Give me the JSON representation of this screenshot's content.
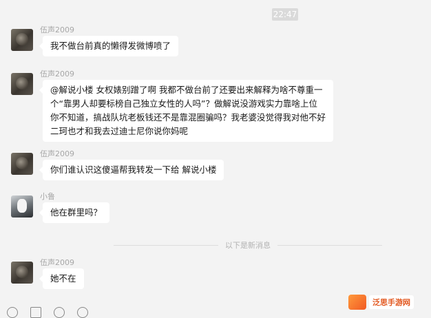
{
  "timestamp": "22:47",
  "messages": [
    {
      "sender": "伍声2009",
      "lines": [
        "我不做台前真的懒得发微博喷了"
      ]
    },
    {
      "sender": "伍声2009",
      "lines": [
        "@解说小楼 女权婊别蹭了啊 我都不做台前了还要出来解释为啥不尊重一",
        "个“靠男人却要标榜自己独立女性的人吗”？做解说没游戏实力靠啥上位",
        "你不知道，搞战队坑老板钱还不是靠混圈骗吗？我老婆没觉得我对他不好",
        "二珂也才和我去过迪士尼你说你妈呢"
      ]
    },
    {
      "sender": "伍声2009",
      "lines": [
        "你们谁认识这傻逼帮我转发一下给 解说小楼"
      ]
    },
    {
      "sender": "小鲁",
      "lines": [
        "他在群里吗？"
      ]
    },
    {
      "sender": "伍声2009",
      "lines": [
        "她不在"
      ]
    }
  ],
  "divider_text": "以下是新消息",
  "watermark": {
    "text": "泛思手游网"
  },
  "icons": [
    "emoji-icon",
    "folder-icon",
    "scissors-icon",
    "chat-history-icon"
  ]
}
